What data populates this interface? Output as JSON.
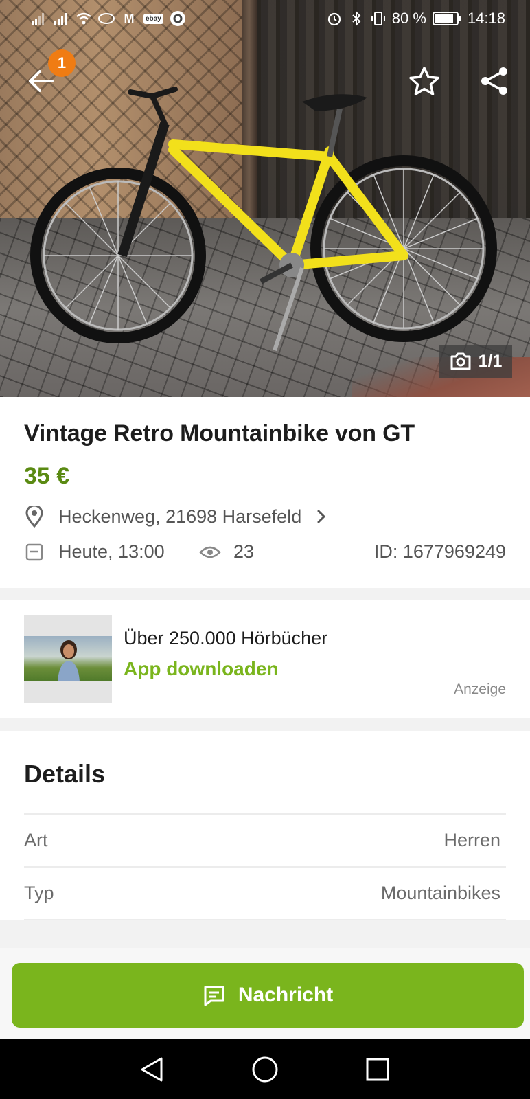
{
  "status_bar": {
    "battery_percent": "80 %",
    "time": "14:18",
    "notification_labels": [
      "M",
      "ebay"
    ]
  },
  "header": {
    "notification_count": "1",
    "image_counter": "1/1"
  },
  "listing": {
    "title": "Vintage Retro Mountainbike von GT",
    "price": "35 €",
    "location": "Heckenweg, 21698 Harsefeld",
    "date": "Heute, 13:00",
    "views": "23",
    "ad_id": "ID: 1677969249"
  },
  "advertisement": {
    "title": "Über 250.000 Hörbücher",
    "cta": "App downloaden",
    "label": "Anzeige"
  },
  "details": {
    "heading": "Details",
    "rows": [
      {
        "key": "Art",
        "value": "Herren"
      },
      {
        "key": "Typ",
        "value": "Mountainbikes"
      }
    ]
  },
  "action": {
    "message_label": "Nachricht"
  },
  "colors": {
    "accent_green": "#7ab51d",
    "price_green": "#5a8a12",
    "badge_orange": "#f07c13"
  },
  "icons": [
    "back-arrow-icon",
    "star-icon",
    "share-icon",
    "camera-icon",
    "location-pin-icon",
    "calendar-icon",
    "eye-icon",
    "chevron-right-icon",
    "chat-icon",
    "nav-back-icon",
    "nav-home-icon",
    "nav-recents-icon"
  ]
}
